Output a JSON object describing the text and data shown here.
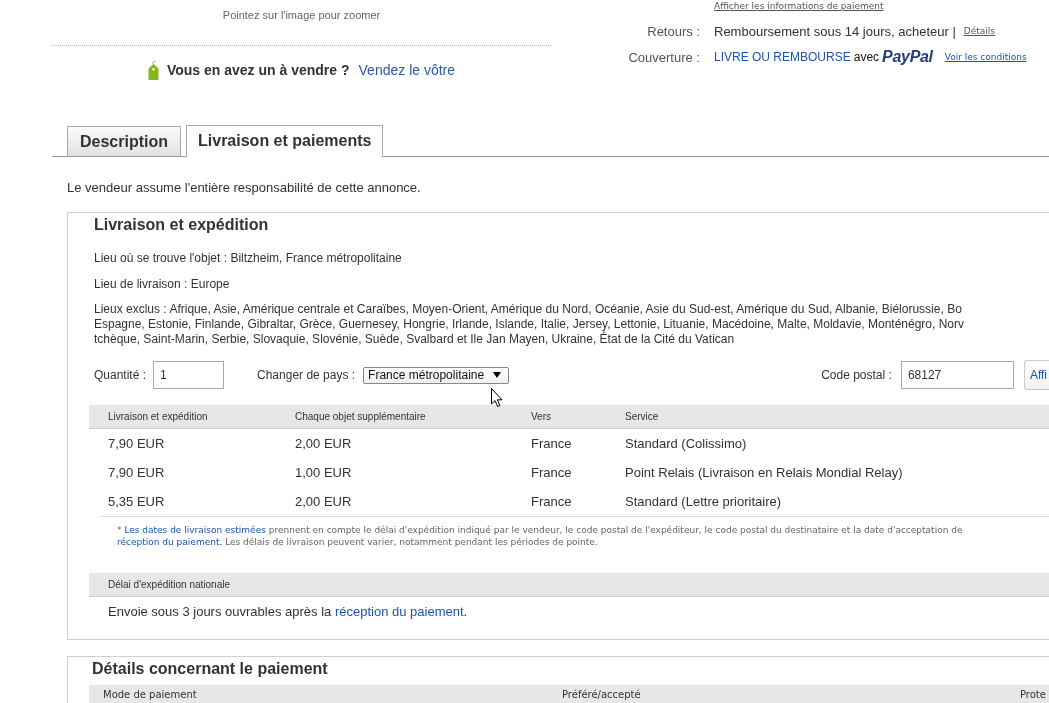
{
  "image_panel": {
    "hint": "Pointez sur l'image pour zoomer"
  },
  "sell_prompt": {
    "question": "Vous en avez un à vendre ?",
    "link": "Vendez le vôtre"
  },
  "item_info": {
    "payment_link": "Afficher les informations de paiement",
    "rows": [
      {
        "kind": "returns",
        "label": "Retours :",
        "value": "Remboursement sous 14 jours, acheteur |",
        "link": "Détails"
      },
      {
        "kind": "coverage",
        "label": "Couverture :",
        "value": "LIVRE OU REMBOURSE",
        "connector": "avec",
        "brand": "PayPal",
        "link": "Voir les conditions"
      }
    ]
  },
  "tabs": [
    {
      "label": "Description",
      "selected": false
    },
    {
      "label": "Livraison et paiements",
      "selected": true
    }
  ],
  "seller_notice": "Le vendeur assume l'entière responsabilité de cette annonce.",
  "shipping": {
    "title": "Livraison et expédition",
    "item_location": "Lieu où se trouve l'objet : Biltzheim, France métropolitaine",
    "ships_to": "Lieu de livraison : Europe",
    "excluded_lines": [
      "Lieux exclus : Afrique, Asie, Amérique centrale et Caraïbes, Moyen-Orient, Amérique du Nord, Océanie, Asie du Sud-est, Amérique du Sud, Albanie, Biélorussie, Bo",
      "Espagne, Estonie, Finlande, Gibraltar, Grèce, Guernesey, Hongrie, Irlande, Islande, Italie, Jersey, Lettonie, Lituanie, Macédoine, Malte, Moldavie, Monténégro, Norv",
      "tchèque, Saint-Marin, Serbie, Slovaquie, Slovénie, Suède, Svalbard et Ile Jan Mayen, Ukraine, État de la Cité du Vatican"
    ],
    "quantity": {
      "label": "Quantité :",
      "value": "1"
    },
    "country": {
      "label": "Changer de pays :",
      "value": "France métropolitaine"
    },
    "postal_code": {
      "label": "Code postal :",
      "value": "68127"
    },
    "apply_button": "Affi",
    "table": {
      "columns": [
        "Livraison et expédition",
        "Chaque objet supplémentaire",
        "Vers",
        "Service"
      ],
      "rows": [
        [
          "7,90 EUR",
          "2,00 EUR",
          "France",
          "Standard (Colissimo)"
        ],
        [
          "7,90 EUR",
          "1,00 EUR",
          "France",
          "Point Relais (Livraison en Relais Mondial Relay)"
        ],
        [
          "5,35 EUR",
          "2,00 EUR",
          "France",
          "Standard (Lettre prioritaire)"
        ]
      ]
    },
    "note_lines": [
      [
        {
          "kind": "text",
          "text": "* "
        },
        {
          "kind": "link",
          "text": "Les dates de livraison estimées"
        },
        {
          "kind": "text",
          "text": " prennent en compte le délai d'expédition indiqué par le vendeur, le code postal de l'expéditeur, le code postal du destinataire et la date d'acceptation de"
        }
      ],
      [
        {
          "kind": "link",
          "text": "réception du paiement."
        },
        {
          "kind": "text",
          "text": " Les délais de livraison peuvent varier, notamment pendant les périodes de pointe."
        }
      ]
    ],
    "handling": {
      "heading": "Délai d'expédition nationale",
      "text": "Envoie sous 3 jours ouvrables après la ",
      "link": "réception du paiement",
      "end": "."
    }
  },
  "payment": {
    "title": "Détails concernant le paiement",
    "columns": [
      "Mode de paiement",
      "Préféré/accepté",
      "Prote"
    ]
  }
}
